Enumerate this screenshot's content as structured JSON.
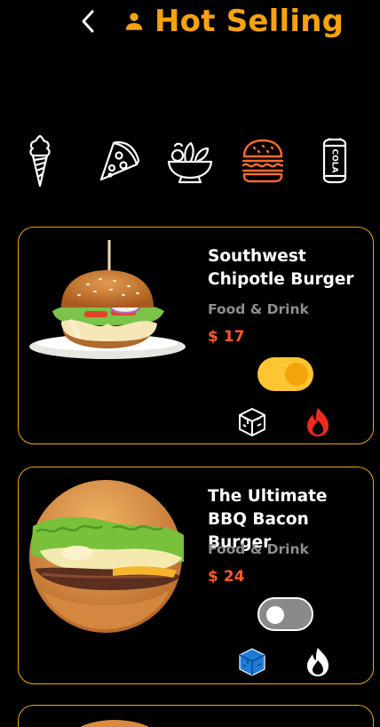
{
  "colors": {
    "accent": "#f5a30b",
    "background": "#000000",
    "price": "#ff5a2a",
    "subtext": "#8e8e8e",
    "toggle_on": "#fcc531",
    "toggle_on_knob": "#f5a30b",
    "toggle_off": "#8a8a8a",
    "selected_category": "#ff6a2b",
    "cold_active": "#1e7bd8",
    "hot_active": "#f02a1e"
  },
  "header": {
    "title": "Hot Selling",
    "back_icon": "chevron-left-icon",
    "user_icon": "person-icon"
  },
  "categories": [
    {
      "name": "ice-cream-icon",
      "selected": false
    },
    {
      "name": "pizza-icon",
      "selected": false
    },
    {
      "name": "salad-icon",
      "selected": false
    },
    {
      "name": "burger-icon",
      "selected": true
    },
    {
      "name": "cola-icon",
      "selected": false
    }
  ],
  "products": [
    {
      "name": "Southwest Chipotle Burger",
      "category": "Food & Drink",
      "price": "$ 17",
      "available": true,
      "cold_active": false,
      "hot_active": true
    },
    {
      "name": "The Ultimate BBQ Bacon Burger",
      "category": "Food & Drink",
      "price": "$ 24",
      "available": false,
      "cold_active": true,
      "hot_active": false
    }
  ]
}
